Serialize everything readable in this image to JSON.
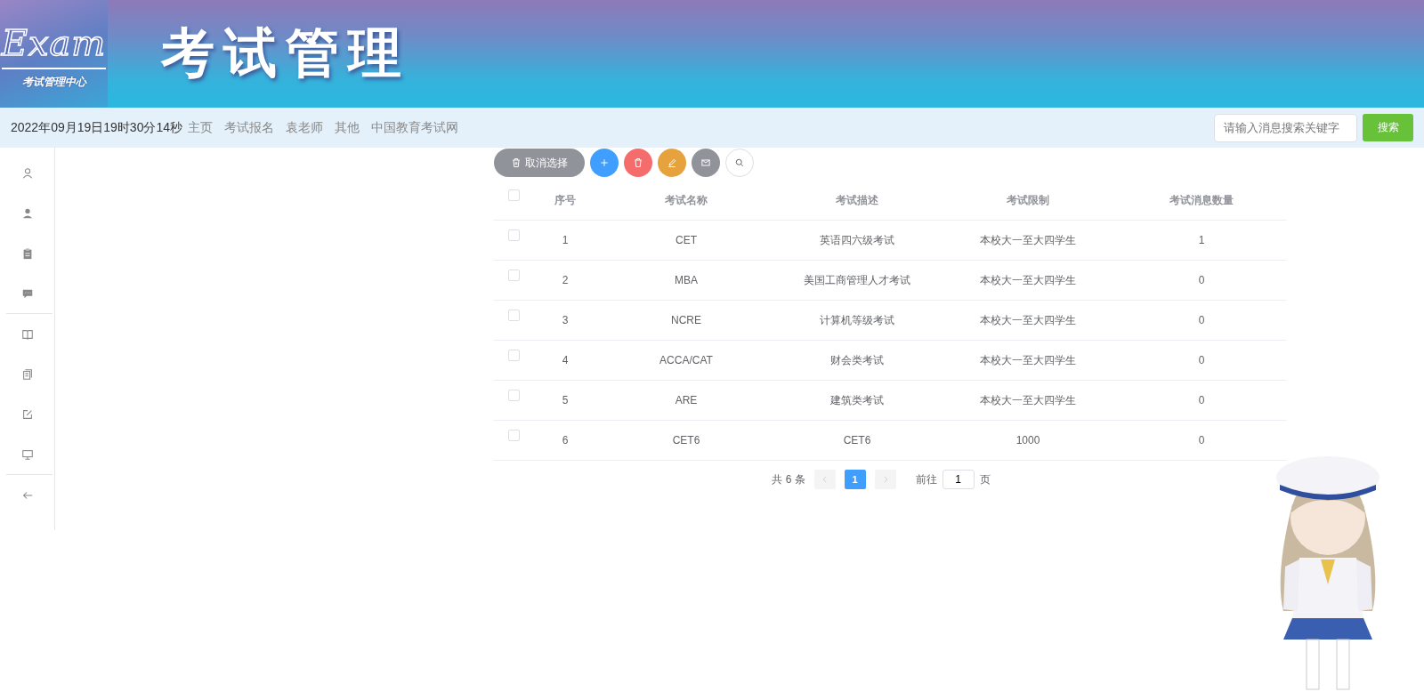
{
  "header": {
    "logo_text": "Exam",
    "logo_subtitle": "考试管理中心",
    "title": "考试管理"
  },
  "nav": {
    "datetime": "2022年09月19日19时30分14秒",
    "links": [
      "主页",
      "考试报名",
      "袁老师",
      "其他",
      "中国教育考试网"
    ]
  },
  "search": {
    "placeholder": "请输入消息搜索关键字",
    "button": "搜索"
  },
  "toolbar": {
    "clear_button": "取消选择"
  },
  "table": {
    "header_checked": false,
    "columns": [
      "序号",
      "考试名称",
      "考试描述",
      "考试限制",
      "考试消息数量"
    ],
    "rows": [
      {
        "checked": false,
        "cells": [
          "1",
          "CET",
          "英语四六级考试",
          "本校大一至大四学生",
          "1"
        ]
      },
      {
        "checked": false,
        "cells": [
          "2",
          "MBA",
          "美国工商管理人才考试",
          "本校大一至大四学生",
          "0"
        ]
      },
      {
        "checked": false,
        "cells": [
          "3",
          "NCRE",
          "计算机等级考试",
          "本校大一至大四学生",
          "0"
        ]
      },
      {
        "checked": false,
        "cells": [
          "4",
          "ACCA/CAT",
          "财会类考试",
          "本校大一至大四学生",
          "0"
        ]
      },
      {
        "checked": false,
        "cells": [
          "5",
          "ARE",
          "建筑类考试",
          "本校大一至大四学生",
          "0"
        ]
      },
      {
        "checked": false,
        "cells": [
          "6",
          "CET6",
          "CET6",
          "1000",
          "0"
        ]
      }
    ]
  },
  "pagination": {
    "total": "共 6 条",
    "pages": [
      {
        "label": "1",
        "selected": true
      }
    ],
    "goto_label": "前往",
    "goto_value": "1",
    "goto_suffix": "页"
  }
}
